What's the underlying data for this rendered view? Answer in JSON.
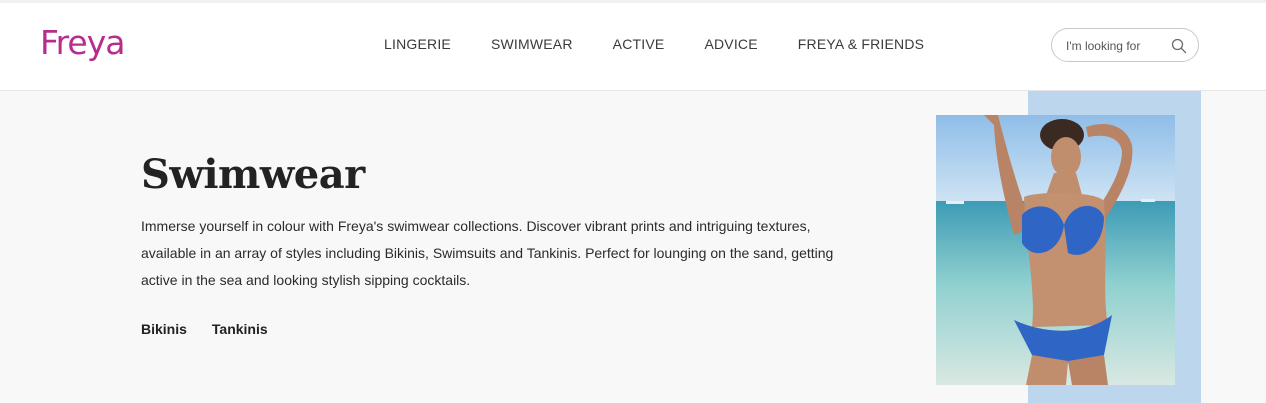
{
  "brand": {
    "name": "Freya",
    "color": "#b62d8e"
  },
  "nav": {
    "items": [
      {
        "label": "LINGERIE"
      },
      {
        "label": "SWIMWEAR"
      },
      {
        "label": "ACTIVE"
      },
      {
        "label": "ADVICE"
      },
      {
        "label": "FREYA & FRIENDS"
      }
    ]
  },
  "search": {
    "placeholder": "I'm looking for",
    "icon": "search-icon"
  },
  "hero": {
    "title": "Swimwear",
    "description": "Immerse yourself in colour with Freya's swimwear collections. Discover vibrant prints and intriguing textures, available in an array of styles including Bikinis, Swimsuits and Tankinis. Perfect for lounging on the sand, getting active in the sea and looking stylish sipping cocktails.",
    "links": [
      {
        "label": "Bikinis"
      },
      {
        "label": "Tankinis"
      }
    ],
    "accent_color": "#bcd6ee"
  }
}
